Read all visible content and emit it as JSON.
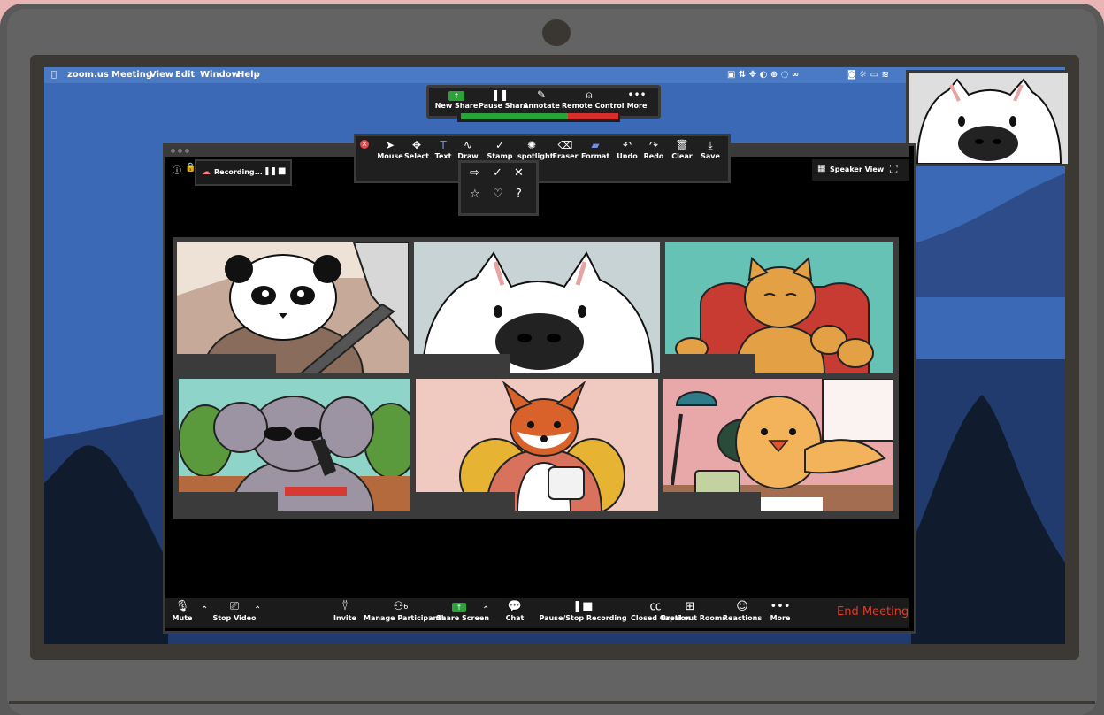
{
  "menubar": {
    "app_icon": "apple-logo-icon",
    "app": "zoom.us",
    "items": [
      "Meeting",
      "View",
      "Edit",
      "Window",
      "Help"
    ]
  },
  "share_toolbar": [
    {
      "label": "New Share",
      "icon": "share-up-icon"
    },
    {
      "label": "Pause Share",
      "icon": "pause-icon"
    },
    {
      "label": "Annotate",
      "icon": "pencil-icon"
    },
    {
      "label": "Remote Control",
      "icon": "mouse-icon"
    },
    {
      "label": "More",
      "icon": "dots-icon"
    }
  ],
  "audio_meter": {
    "level": 0.68,
    "green": "#2ca33a",
    "red": "#d62d2d"
  },
  "recording": {
    "label": "Recording..."
  },
  "annotation_toolbar": [
    {
      "label": "Mouse",
      "icon": "cursor-icon"
    },
    {
      "label": "Select",
      "icon": "move-icon"
    },
    {
      "label": "Text",
      "icon": "text-icon"
    },
    {
      "label": "Draw",
      "icon": "squiggle-icon"
    },
    {
      "label": "Stamp",
      "icon": "check-icon"
    },
    {
      "label": "spotlight",
      "icon": "spotlight-icon"
    },
    {
      "label": "Eraser",
      "icon": "eraser-icon"
    },
    {
      "label": "Format",
      "icon": "format-icon"
    },
    {
      "label": "Undo",
      "icon": "undo-icon"
    },
    {
      "label": "Redo",
      "icon": "redo-icon"
    },
    {
      "label": "Clear",
      "icon": "trash-icon"
    },
    {
      "label": "Save",
      "icon": "save-icon"
    }
  ],
  "stamp_menu": {
    "row1": [
      "⇨",
      "✓",
      "✕"
    ],
    "row2": [
      "☆",
      "♡",
      "?"
    ]
  },
  "view": {
    "speaker_view": "Speaker View"
  },
  "participants_grid": [
    {
      "animal": "panda",
      "bg": "#c7a99a"
    },
    {
      "animal": "samoyed-dog",
      "bg": "#c7d3d4"
    },
    {
      "animal": "orange-cat",
      "bg": "#66c2b4"
    },
    {
      "animal": "elephant",
      "bg": "#8fd4c8"
    },
    {
      "animal": "fox",
      "bg": "#f0c9c0"
    },
    {
      "animal": "chick",
      "bg": "#e8a7a8"
    }
  ],
  "bottom_toolbar": [
    {
      "label": "Mute",
      "icon": "microphone-icon"
    },
    {
      "label": "Stop Video",
      "icon": "video-camera-icon"
    },
    {
      "label": "Invite",
      "icon": "add-person-icon"
    },
    {
      "label": "Manage Participants",
      "icon": "participants-icon",
      "count": "6"
    },
    {
      "label": "Share Screen",
      "icon": "share-screen-icon"
    },
    {
      "label": "Chat",
      "icon": "chat-bubble-icon"
    },
    {
      "label": "Pause/Stop Recording",
      "icon": "pause-stop-icon"
    },
    {
      "label": "Closed Caption",
      "icon": "cc-icon"
    },
    {
      "label": "Breakout Rooms",
      "icon": "grid-icon"
    },
    {
      "label": "Reactions",
      "icon": "smiley-icon"
    },
    {
      "label": "More",
      "icon": "dots-icon"
    }
  ],
  "end_meeting": "End Meeting"
}
